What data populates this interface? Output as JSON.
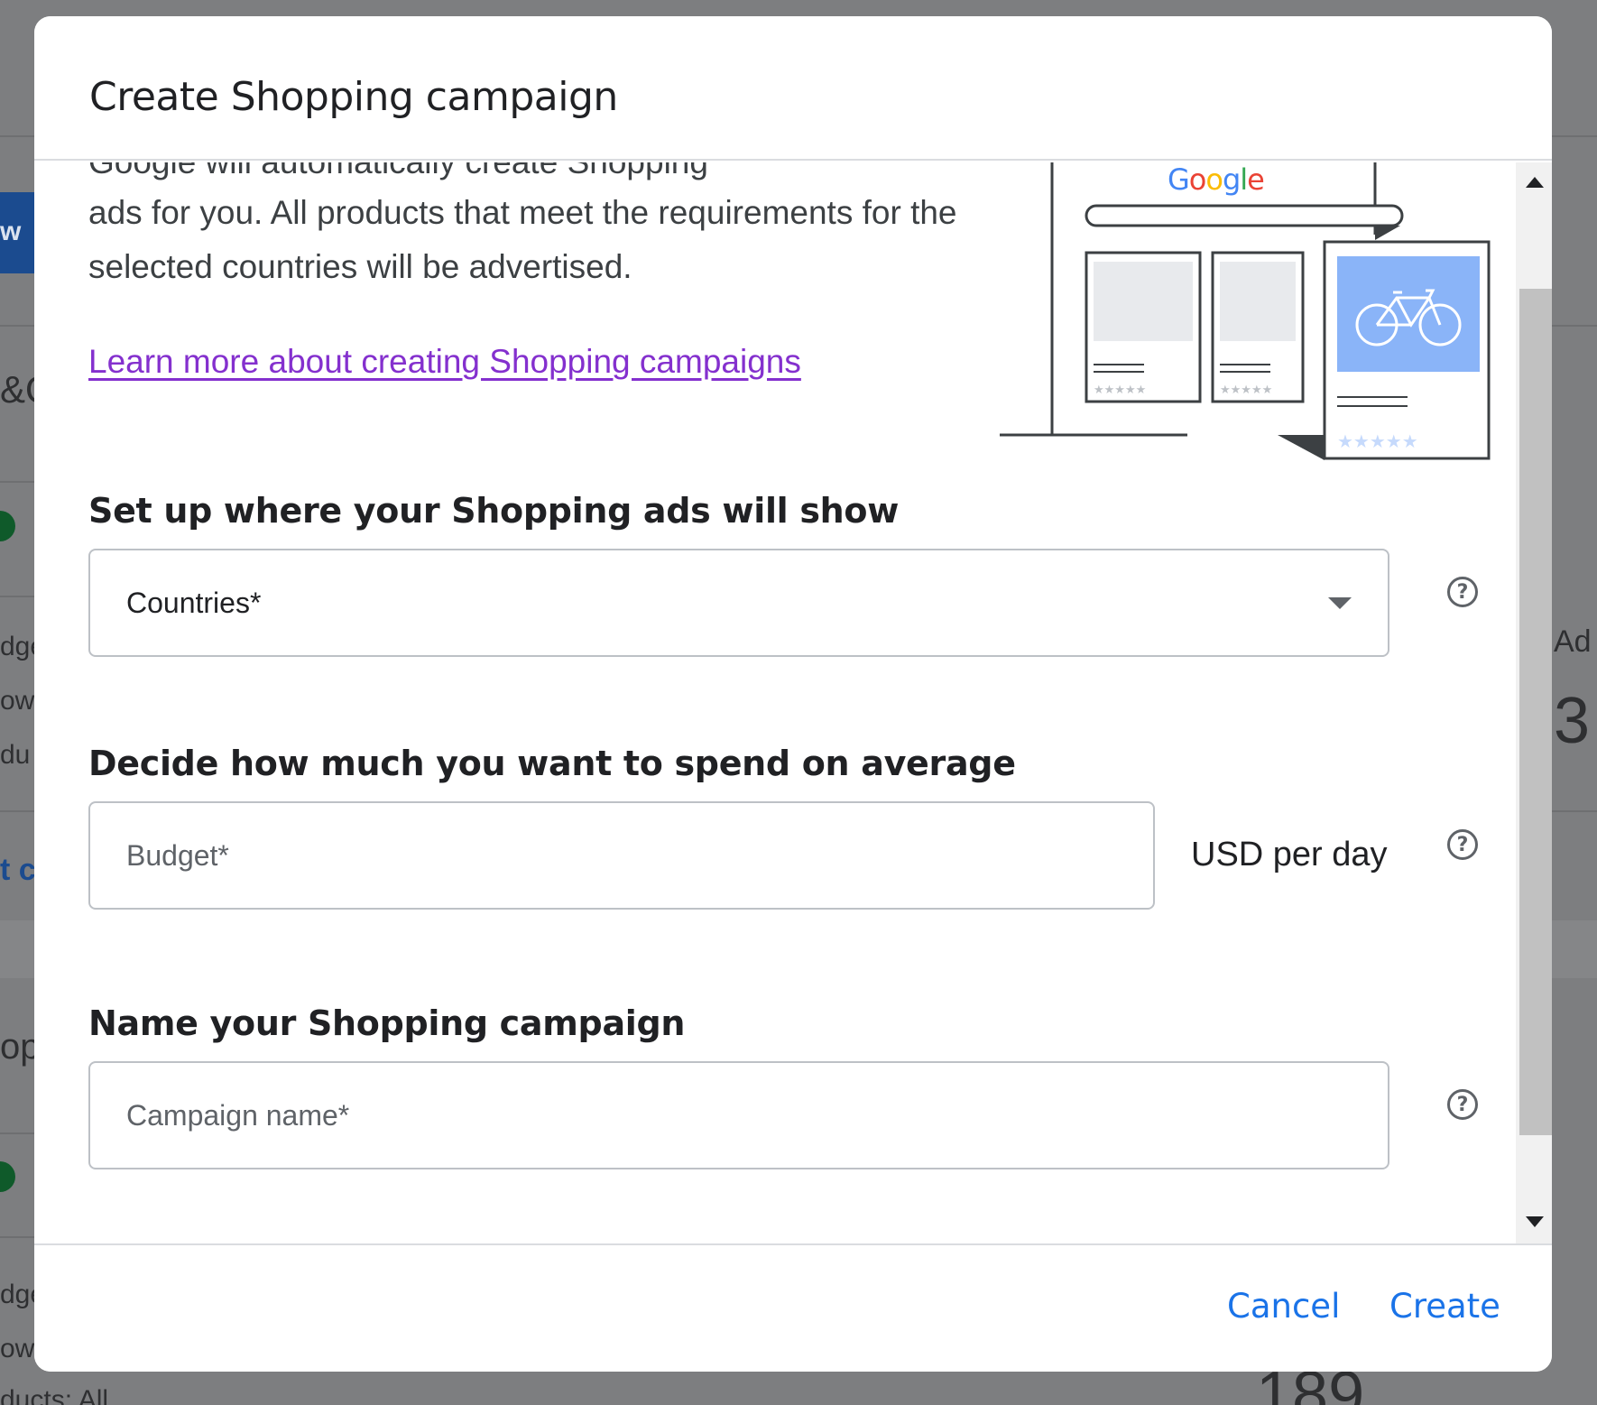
{
  "background": {
    "left_fragments": [
      "&O",
      "dge",
      "owi",
      "du",
      "t c",
      "op",
      "dge",
      "owi",
      "ducts: All"
    ],
    "right_fragments": [
      "Ad",
      "3",
      "189"
    ],
    "button_fragment": "w"
  },
  "dialog": {
    "title": "Create Shopping campaign",
    "intro_partial": "Google will automatically create Shopping",
    "intro_text": "ads for you. All products that meet the requirements for the selected countries will be advertised.",
    "learn_more_link": "Learn more about creating Shopping campaigns",
    "illustration": {
      "brand": "Google",
      "bar_color": "#8ab4f8"
    },
    "sections": {
      "location": {
        "heading": "Set up where your Shopping ads will show",
        "select_label": "Countries*"
      },
      "budget": {
        "heading": "Decide how much you want to spend on average",
        "placeholder": "Budget*",
        "unit": "USD per day"
      },
      "name": {
        "heading": "Name your Shopping campaign",
        "placeholder": "Campaign name*"
      }
    },
    "footer": {
      "cancel_label": "Cancel",
      "create_label": "Create"
    },
    "colors": {
      "link": "#8430ce",
      "primary": "#1a73e8"
    }
  }
}
